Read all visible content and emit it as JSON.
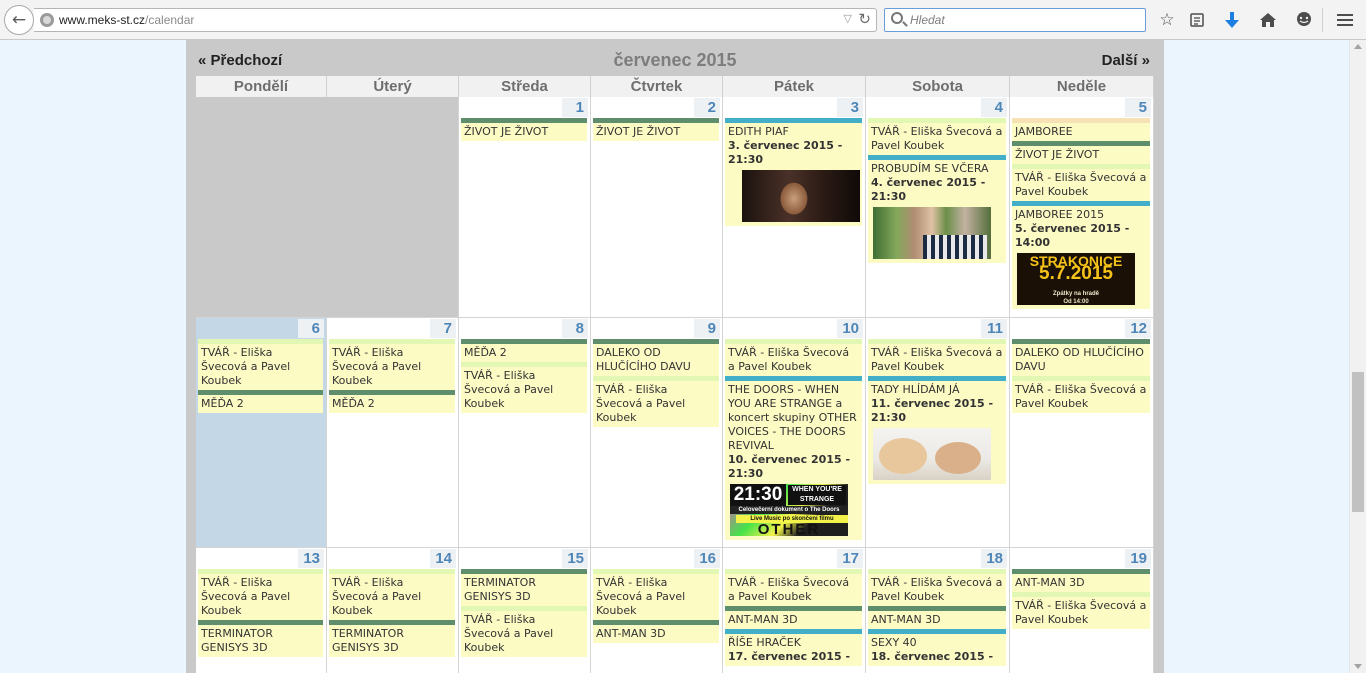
{
  "browser": {
    "url_host": "www.meks-st.cz",
    "url_path": "/calendar",
    "search_placeholder": "Hledat"
  },
  "calendar": {
    "prev_label": "« Předchozí",
    "next_label": "Další »",
    "month_title": "červenec 2015",
    "weekdays": [
      "Pondělí",
      "Úterý",
      "Středa",
      "Čtvrtek",
      "Pátek",
      "Sobota",
      "Neděle"
    ],
    "week1": {
      "wed": {
        "day": "1",
        "e1": "ŽIVOT JE ŽIVOT"
      },
      "thu": {
        "day": "2",
        "e1": "ŽIVOT JE ŽIVOT"
      },
      "fri": {
        "day": "3",
        "e1": "EDITH PIAF",
        "e1_date": "3. červenec 2015 - 21:30"
      },
      "sat": {
        "day": "4",
        "e1": "TVÁŘ - Eliška Švecová a Pavel Koubek",
        "e2": "PROBUDÍM SE VČERA",
        "e2_date": "4. červenec 2015 - 21:30"
      },
      "sun": {
        "day": "5",
        "e1": "JAMBOREE",
        "e2": "ŽIVOT JE ŽIVOT",
        "e3": "TVÁŘ - Eliška Švecová a Pavel Koubek",
        "e4": "JAMBOREE 2015",
        "e4_date": "5. červenec 2015 - 14:00",
        "poster_main": "STRAKONICE",
        "poster_date": "5.7.2015",
        "poster_sub1": "Zpátky na hradě",
        "poster_sub2": "Od 14:00"
      }
    },
    "week2": {
      "mon": {
        "day": "6",
        "e1": "TVÁŘ - Eliška Švecová a Pavel Koubek",
        "e2": "MĚĎA 2"
      },
      "tue": {
        "day": "7",
        "e1": "TVÁŘ - Eliška Švecová a Pavel Koubek",
        "e2": "MĚĎA 2"
      },
      "wed": {
        "day": "8",
        "e1": "MĚĎA 2",
        "e2": "TVÁŘ - Eliška Švecová a Pavel Koubek"
      },
      "thu": {
        "day": "9",
        "e1": "DALEKO OD HLUČÍCÍHO DAVU",
        "e2": "TVÁŘ - Eliška Švecová a Pavel Koubek"
      },
      "fri": {
        "day": "10",
        "e1": "TVÁŘ - Eliška Švecová a Pavel Koubek",
        "e2": "THE DOORS - WHEN YOU ARE STRANGE a koncert skupiny OTHER VOICES - THE DOORS REVIVAL",
        "e2_date": "10. červenec 2015 - 21:30",
        "poster_time": "21:30",
        "poster_title": "WHEN YOU'RE STRANGE",
        "poster_line1": "Celovečerní dokument o The Doors",
        "poster_line2": "Live Music po skončení filmu",
        "poster_band": "OTHER"
      },
      "sat": {
        "day": "11",
        "e1": "TVÁŘ - Eliška Švecová a Pavel Koubek",
        "e2": "TADY HLÍDÁM JÁ",
        "e2_date": "11. červenec 2015 - 21:30"
      },
      "sun": {
        "day": "12",
        "e1": "DALEKO OD HLUČÍCÍHO DAVU",
        "e2": "TVÁŘ - Eliška Švecová a Pavel Koubek"
      }
    },
    "week3": {
      "mon": {
        "day": "13",
        "e1": "TVÁŘ - Eliška Švecová a Pavel Koubek",
        "e2": "TERMINATOR GENISYS 3D"
      },
      "tue": {
        "day": "14",
        "e1": "TVÁŘ - Eliška Švecová a Pavel Koubek",
        "e2": "TERMINATOR GENISYS 3D"
      },
      "wed": {
        "day": "15",
        "e1": "TERMINATOR GENISYS 3D",
        "e2": "TVÁŘ - Eliška Švecová a Pavel Koubek"
      },
      "thu": {
        "day": "16",
        "e1": "TVÁŘ - Eliška Švecová a Pavel Koubek",
        "e2": "ANT-MAN 3D"
      },
      "fri": {
        "day": "17",
        "e1": "TVÁŘ - Eliška Švecová a Pavel Koubek",
        "e2": "ANT-MAN 3D",
        "e3": "ŘÍŠE HRAČEK",
        "e3_date": "17. červenec 2015 -"
      },
      "sat": {
        "day": "18",
        "e1": "TVÁŘ - Eliška Švecová a Pavel Koubek",
        "e2": "ANT-MAN 3D",
        "e3": "SEXY 40",
        "e3_date": "18. červenec 2015 -"
      },
      "sun": {
        "day": "19",
        "e1": "ANT-MAN 3D",
        "e2": "TVÁŘ - Eliška Švecová a Pavel Koubek"
      }
    }
  }
}
